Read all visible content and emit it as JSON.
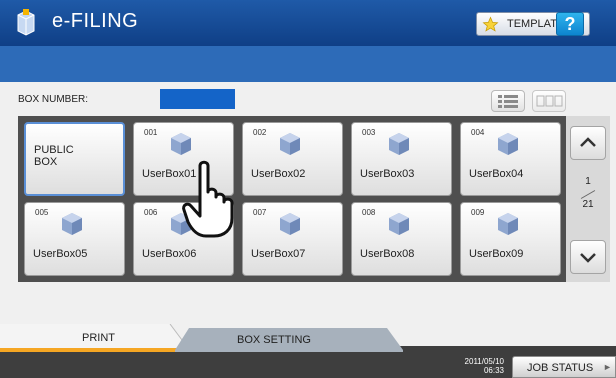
{
  "header": {
    "app_title": "e-FILING",
    "template_label": "TEMPLATE",
    "help_label": "?"
  },
  "box_number": {
    "label": "BOX NUMBER:"
  },
  "boxes": [
    {
      "num": "",
      "label": "PUBLIC\nBOX"
    },
    {
      "num": "001",
      "label": "UserBox01"
    },
    {
      "num": "002",
      "label": "UserBox02"
    },
    {
      "num": "003",
      "label": "UserBox03"
    },
    {
      "num": "004",
      "label": "UserBox04"
    },
    {
      "num": "005",
      "label": "UserBox05"
    },
    {
      "num": "006",
      "label": "UserBox06"
    },
    {
      "num": "007",
      "label": "UserBox07"
    },
    {
      "num": "008",
      "label": "UserBox08"
    },
    {
      "num": "009",
      "label": "UserBox09"
    }
  ],
  "pager": {
    "current": "1",
    "total": "21"
  },
  "tabs": {
    "print": "PRINT",
    "box_setting": "BOX SETTING"
  },
  "status": {
    "date": "2011/05/10",
    "time": "06:33",
    "job_status": "JOB STATUS"
  },
  "colors": {
    "title_bar": "#1f5aa8",
    "accent_bar": "#2d6bb8",
    "box_number_field": "#1464c8",
    "print_tab": "#f5a623"
  }
}
